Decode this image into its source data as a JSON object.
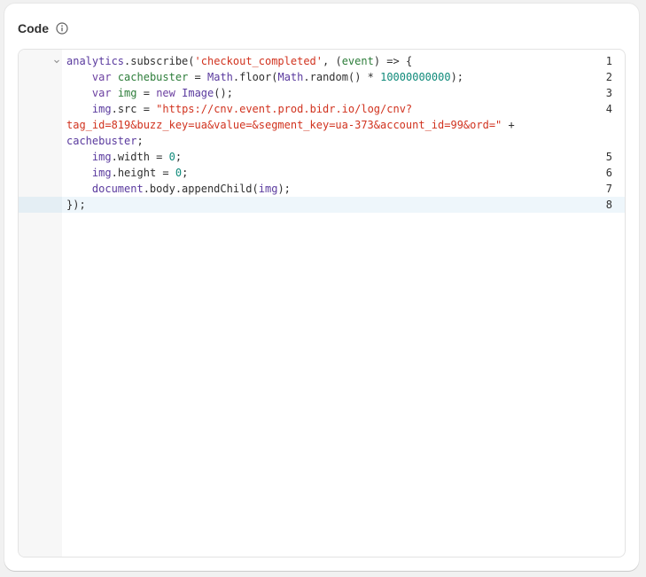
{
  "card": {
    "title": "Code",
    "info_icon": "info-circle-icon"
  },
  "editor": {
    "active_line": 8,
    "line_numbers": [
      "1",
      "2",
      "3",
      "4",
      "5",
      "6",
      "7",
      "8"
    ],
    "fold_icon": "chevron-down-icon",
    "lines": [
      [
        {
          "t": "analytics",
          "c": "tok-var"
        },
        {
          "t": ".subscribe(",
          "c": "tok-plain"
        },
        {
          "t": "'checkout_completed'",
          "c": "tok-str"
        },
        {
          "t": ", (",
          "c": "tok-plain"
        },
        {
          "t": "event",
          "c": "tok-param"
        },
        {
          "t": ") => {",
          "c": "tok-plain"
        }
      ],
      [
        {
          "t": "    ",
          "c": "tok-plain"
        },
        {
          "t": "var",
          "c": "tok-kw"
        },
        {
          "t": " ",
          "c": "tok-plain"
        },
        {
          "t": "cachebuster",
          "c": "tok-param"
        },
        {
          "t": " = ",
          "c": "tok-plain"
        },
        {
          "t": "Math",
          "c": "tok-var"
        },
        {
          "t": ".floor(",
          "c": "tok-plain"
        },
        {
          "t": "Math",
          "c": "tok-var"
        },
        {
          "t": ".random() * ",
          "c": "tok-plain"
        },
        {
          "t": "10000000000",
          "c": "tok-num"
        },
        {
          "t": ");",
          "c": "tok-plain"
        }
      ],
      [
        {
          "t": "    ",
          "c": "tok-plain"
        },
        {
          "t": "var",
          "c": "tok-kw"
        },
        {
          "t": " ",
          "c": "tok-plain"
        },
        {
          "t": "img",
          "c": "tok-param"
        },
        {
          "t": " = ",
          "c": "tok-plain"
        },
        {
          "t": "new",
          "c": "tok-kw"
        },
        {
          "t": " ",
          "c": "tok-plain"
        },
        {
          "t": "Image",
          "c": "tok-var"
        },
        {
          "t": "();",
          "c": "tok-plain"
        }
      ],
      [
        {
          "t": "    ",
          "c": "tok-plain"
        },
        {
          "t": "img",
          "c": "tok-var"
        },
        {
          "t": ".src = ",
          "c": "tok-plain"
        },
        {
          "t": "\"https://cnv.event.prod.bidr.io/log/cnv?",
          "c": "tok-str"
        }
      ],
      [
        {
          "t": "tag_id=819&buzz_key=ua&value=&segment_key=ua-373&account_id=99&ord=\"",
          "c": "tok-str"
        },
        {
          "t": " +",
          "c": "tok-plain"
        }
      ],
      [
        {
          "t": "cachebuster",
          "c": "tok-var"
        },
        {
          "t": ";",
          "c": "tok-plain"
        }
      ],
      [
        {
          "t": "    ",
          "c": "tok-plain"
        },
        {
          "t": "img",
          "c": "tok-var"
        },
        {
          "t": ".width = ",
          "c": "tok-plain"
        },
        {
          "t": "0",
          "c": "tok-num"
        },
        {
          "t": ";",
          "c": "tok-plain"
        }
      ],
      [
        {
          "t": "    ",
          "c": "tok-plain"
        },
        {
          "t": "img",
          "c": "tok-var"
        },
        {
          "t": ".height = ",
          "c": "tok-plain"
        },
        {
          "t": "0",
          "c": "tok-num"
        },
        {
          "t": ";",
          "c": "tok-plain"
        }
      ],
      [
        {
          "t": "    ",
          "c": "tok-plain"
        },
        {
          "t": "document",
          "c": "tok-var"
        },
        {
          "t": ".body.appendChild(",
          "c": "tok-plain"
        },
        {
          "t": "img",
          "c": "tok-var"
        },
        {
          "t": ");",
          "c": "tok-plain"
        }
      ],
      [
        {
          "t": "});",
          "c": "tok-plain"
        }
      ]
    ]
  }
}
